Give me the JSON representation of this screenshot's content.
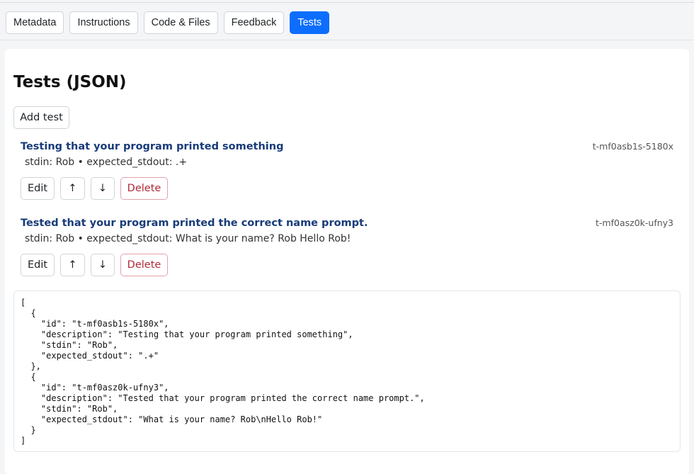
{
  "tabs": [
    {
      "label": "Metadata",
      "active": false
    },
    {
      "label": "Instructions",
      "active": false
    },
    {
      "label": "Code & Files",
      "active": false
    },
    {
      "label": "Feedback",
      "active": false
    },
    {
      "label": "Tests",
      "active": true
    }
  ],
  "page": {
    "title": "Tests (JSON)",
    "add_test_label": "Add test"
  },
  "tests": [
    {
      "description": "Testing that your program printed something",
      "meta": "stdin: Rob • expected_stdout: .+",
      "id": "t-mf0asb1s-5180x",
      "edit_label": "Edit",
      "up_label": "↑",
      "down_label": "↓",
      "delete_label": "Delete"
    },
    {
      "description": "Tested that your program printed the correct name prompt.",
      "meta": "stdin: Rob • expected_stdout: What is your name? Rob Hello Rob!",
      "id": "t-mf0asz0k-ufny3",
      "edit_label": "Edit",
      "up_label": "↑",
      "down_label": "↓",
      "delete_label": "Delete"
    }
  ],
  "json_text": "[\n  {\n    \"id\": \"t-mf0asb1s-5180x\",\n    \"description\": \"Testing that your program printed something\",\n    \"stdin\": \"Rob\",\n    \"expected_stdout\": \".+\"\n  },\n  {\n    \"id\": \"t-mf0asz0k-ufny3\",\n    \"description\": \"Tested that your program printed the correct name prompt.\",\n    \"stdin\": \"Rob\",\n    \"expected_stdout\": \"What is your name? Rob\\nHello Rob!\"\n  }\n]",
  "colors": {
    "accent": "#0d6efd",
    "test_title": "#183b7a",
    "danger": "#b02a37"
  }
}
